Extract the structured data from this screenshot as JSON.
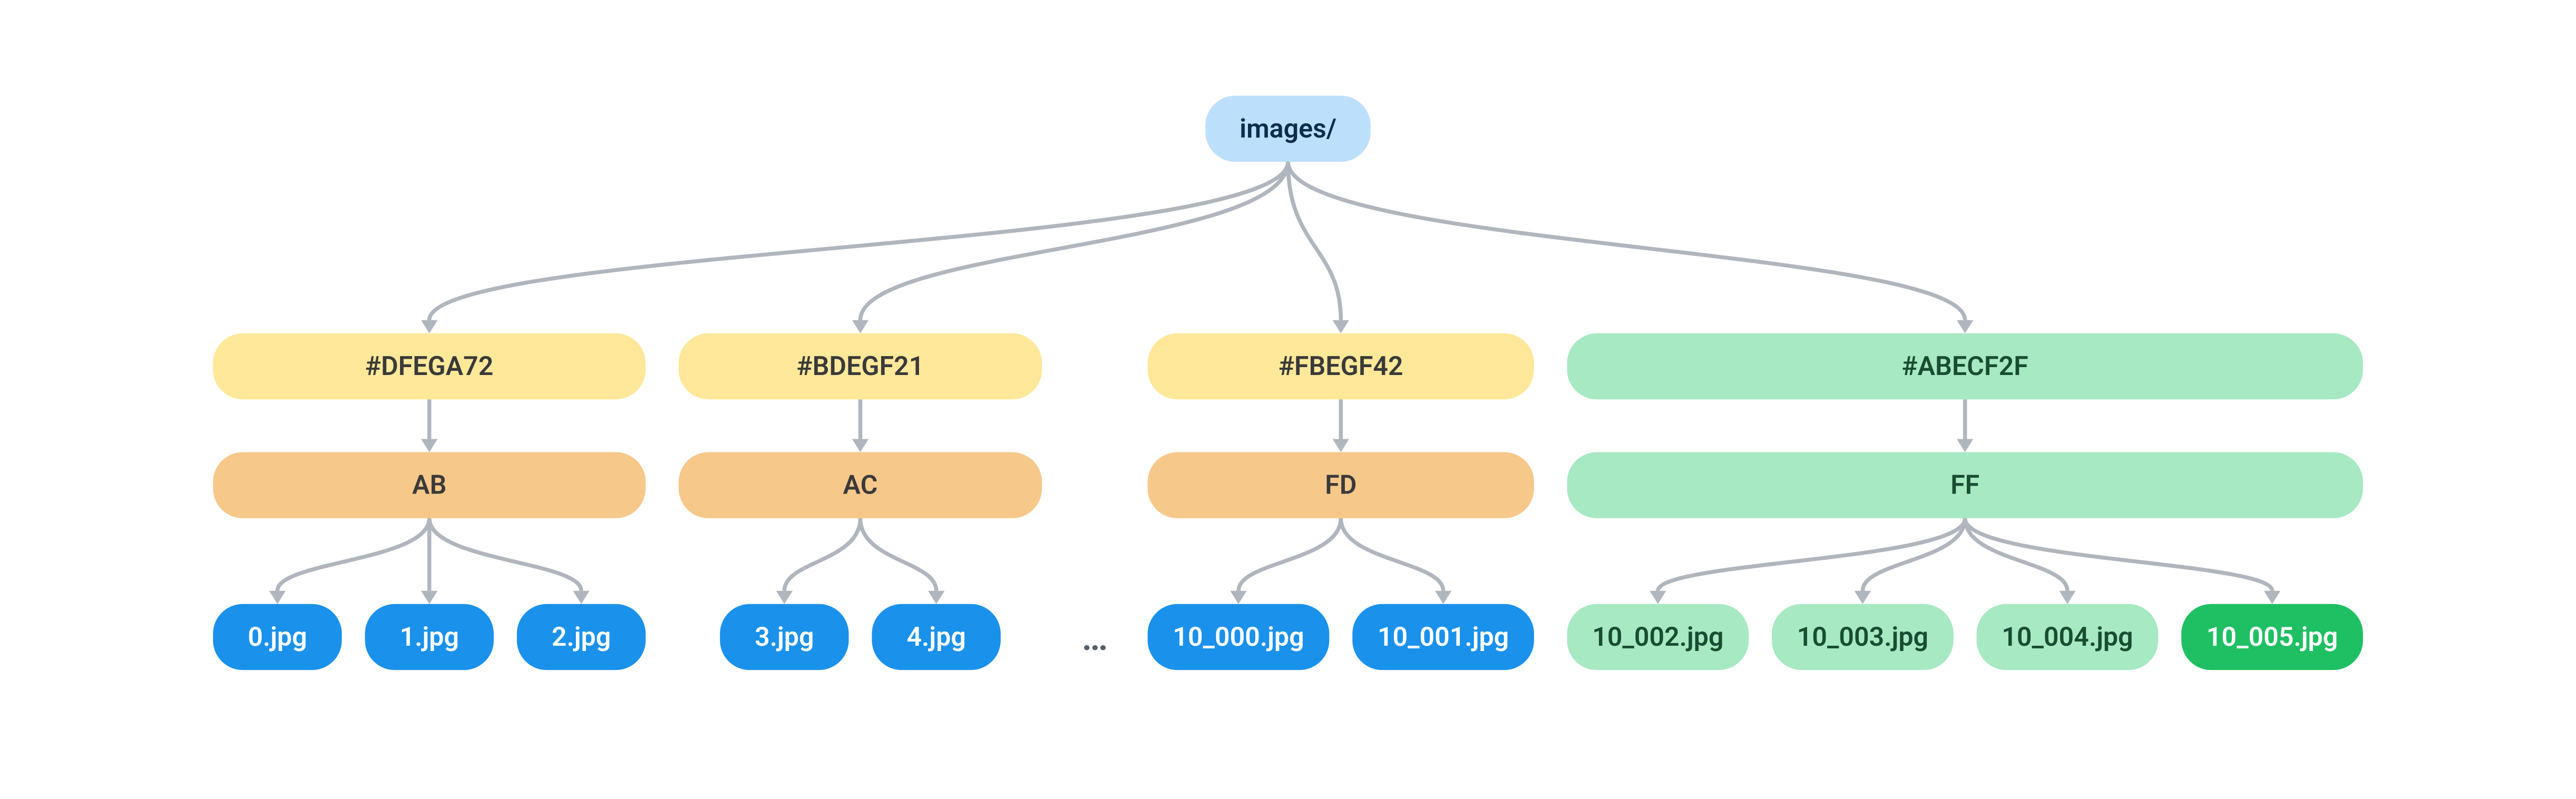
{
  "root": {
    "label": "images/"
  },
  "branches": [
    {
      "hash": "#DFEGA72",
      "sub": "AB",
      "style": "normal",
      "files": [
        {
          "label": "0.jpg",
          "style": "blue"
        },
        {
          "label": "1.jpg",
          "style": "blue"
        },
        {
          "label": "2.jpg",
          "style": "blue"
        }
      ]
    },
    {
      "hash": "#BDEGF21",
      "sub": "AC",
      "style": "normal",
      "files": [
        {
          "label": "3.jpg",
          "style": "blue"
        },
        {
          "label": "4.jpg",
          "style": "blue"
        }
      ]
    },
    {
      "hash": "#FBEGF42",
      "sub": "FD",
      "style": "normal",
      "files": [
        {
          "label": "10_000.jpg",
          "style": "blue"
        },
        {
          "label": "10_001.jpg",
          "style": "blue"
        }
      ]
    },
    {
      "hash": "#ABECF2F",
      "sub": "FF",
      "style": "green",
      "files": [
        {
          "label": "10_002.jpg",
          "style": "lightgreen"
        },
        {
          "label": "10_003.jpg",
          "style": "lightgreen"
        },
        {
          "label": "10_004.jpg",
          "style": "lightgreen"
        },
        {
          "label": "10_005.jpg",
          "style": "darkgreen"
        }
      ]
    }
  ],
  "ellipsis": "…",
  "colors": {
    "root_bg": "#bcdffb",
    "root_fg": "#0b2c4a",
    "hash_bg": "#ffe89a",
    "hash_fg": "#3a3a3a",
    "sub_bg": "#f6c88a",
    "sub_fg": "#3a3a3a",
    "green_bg": "#a6e9c2",
    "green_fg": "#184d33",
    "blue_bg": "#1a91eb",
    "blue_fg": "#ffffff",
    "lg_bg": "#a6e9c2",
    "lg_fg": "#184d33",
    "dg_bg": "#1fbf63",
    "dg_fg": "#ffffff",
    "edge": "#b0b6be"
  }
}
